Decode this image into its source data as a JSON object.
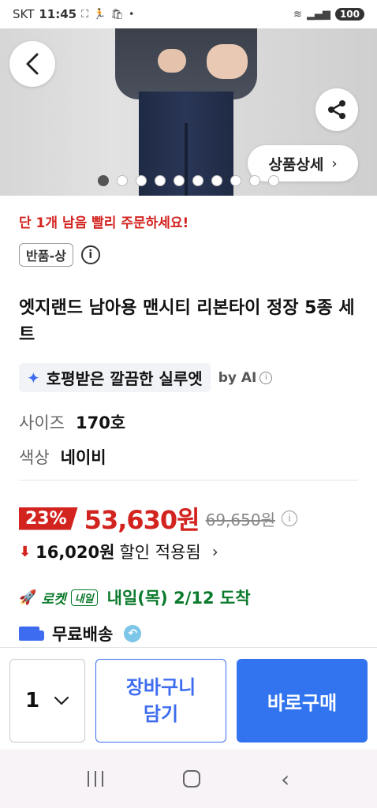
{
  "status_bar": {
    "carrier": "SKT",
    "time": "11:45",
    "battery": "100"
  },
  "hero": {
    "detail_button_label": "상품상세",
    "carousel_total": 10,
    "carousel_active_index": 0
  },
  "product": {
    "urgency": "단 1개 남음 빨리 주문하세요!",
    "grade_badge": "반품-상",
    "title": "엣지랜드 남아용 맨시티 리본타이 정장 5종 세트",
    "ai_summary": "호평받은 깔끔한 실루엣",
    "ai_by": "by AI"
  },
  "options": {
    "size_label": "사이즈",
    "size_value": "170호",
    "color_label": "색상",
    "color_value": "네이비"
  },
  "price": {
    "discount_rate": "23%",
    "sale_price": "53,630원",
    "original_price": "69,650원",
    "discount_amount": "16,020원",
    "discount_text": "할인 적용됨"
  },
  "delivery": {
    "rocket_label": "로켓",
    "naeil_badge": "내일",
    "arrival_text": "내일(목) 2/12 도착",
    "free_shipping": "무료배송"
  },
  "actions": {
    "quantity": "1",
    "cart_line1": "장바구니",
    "cart_line2": "담기",
    "buy_label": "바로구매"
  },
  "colors": {
    "accent_red": "#d3231f",
    "accent_blue": "#3274f0",
    "delivery_green": "#0b7a2c"
  }
}
